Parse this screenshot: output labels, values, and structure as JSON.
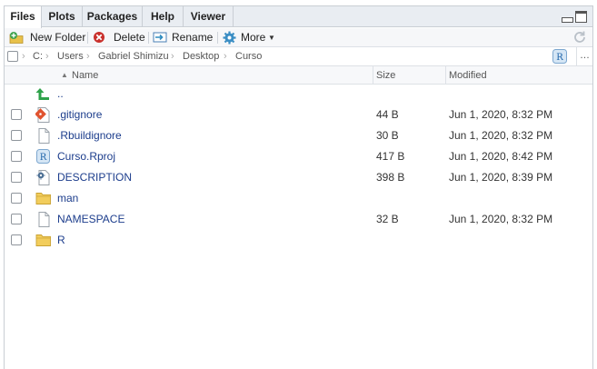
{
  "tabs": [
    {
      "label": "Files"
    },
    {
      "label": "Plots"
    },
    {
      "label": "Packages"
    },
    {
      "label": "Help"
    },
    {
      "label": "Viewer"
    }
  ],
  "toolbar": {
    "new_folder": "New Folder",
    "delete": "Delete",
    "rename": "Rename",
    "more": "More"
  },
  "path": {
    "crumbs": [
      "C:",
      "Users",
      "Gabriel Shimizu",
      "Desktop",
      "Curso"
    ]
  },
  "columns": {
    "name": "Name",
    "size": "Size",
    "modified": "Modified",
    "sort_indicator": "▲"
  },
  "files": [
    {
      "name": "..",
      "size": "",
      "modified": "",
      "icon": "parent-dir-icon"
    },
    {
      "name": ".gitignore",
      "size": "44 B",
      "modified": "Jun 1, 2020, 8:32 PM",
      "icon": "gitignore-file-icon"
    },
    {
      "name": ".Rbuildignore",
      "size": "30 B",
      "modified": "Jun 1, 2020, 8:32 PM",
      "icon": "text-file-icon"
    },
    {
      "name": "Curso.Rproj",
      "size": "417 B",
      "modified": "Jun 1, 2020, 8:42 PM",
      "icon": "rproj-file-icon"
    },
    {
      "name": "DESCRIPTION",
      "size": "398 B",
      "modified": "Jun 1, 2020, 8:39 PM",
      "icon": "description-file-icon"
    },
    {
      "name": "man",
      "size": "",
      "modified": "",
      "icon": "folder-icon"
    },
    {
      "name": "NAMESPACE",
      "size": "32 B",
      "modified": "Jun 1, 2020, 8:32 PM",
      "icon": "text-file-icon"
    },
    {
      "name": "R",
      "size": "",
      "modified": "",
      "icon": "folder-icon"
    }
  ],
  "colors": {
    "link": "#1c3d8c",
    "tabbar": "#e9edf2",
    "border": "#c9ced4"
  }
}
